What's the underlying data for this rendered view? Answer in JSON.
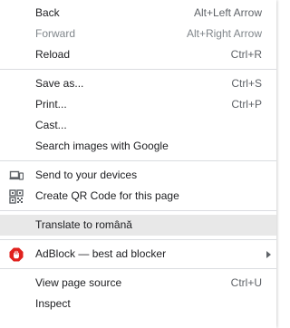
{
  "menu": {
    "back": {
      "label": "Back",
      "shortcut": "Alt+Left Arrow"
    },
    "forward": {
      "label": "Forward",
      "shortcut": "Alt+Right Arrow"
    },
    "reload": {
      "label": "Reload",
      "shortcut": "Ctrl+R"
    },
    "save_as": {
      "label": "Save as...",
      "shortcut": "Ctrl+S"
    },
    "print": {
      "label": "Print...",
      "shortcut": "Ctrl+P"
    },
    "cast": {
      "label": "Cast..."
    },
    "search_images": {
      "label": "Search images with Google"
    },
    "send_to_devices": {
      "label": "Send to your devices",
      "icon": "devices-icon"
    },
    "qr_code": {
      "label": "Create QR Code for this page",
      "icon": "qr-code-icon"
    },
    "translate": {
      "label": "Translate to română"
    },
    "adblock": {
      "label": "AdBlock — best ad blocker",
      "icon": "adblock-icon",
      "icon_color": "#e0211d"
    },
    "view_source": {
      "label": "View page source",
      "shortcut": "Ctrl+U"
    },
    "inspect": {
      "label": "Inspect"
    }
  }
}
